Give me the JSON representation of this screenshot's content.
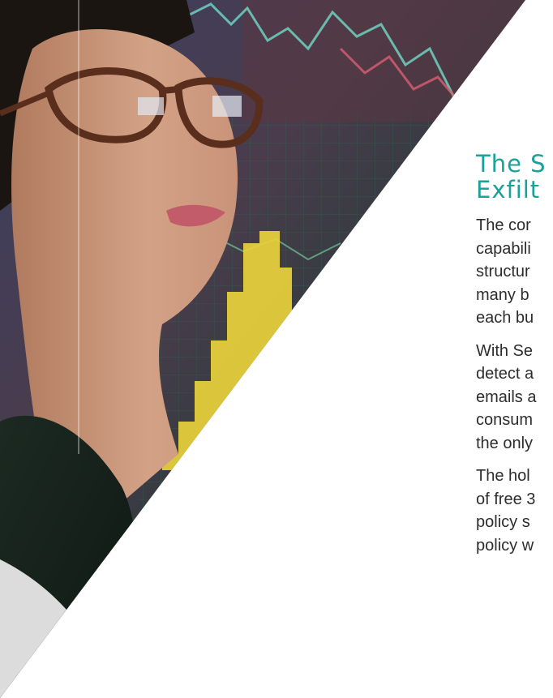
{
  "article": {
    "heading_lines": [
      "The S",
      "Exfilt"
    ],
    "paragraphs": [
      [
        "The cor",
        "capabili",
        "structur",
        "many b",
        "each bu"
      ],
      [
        "With Se",
        "detect a",
        "emails a",
        "consum",
        "the only"
      ],
      [
        "The hol",
        "of free 3",
        "policy s",
        "policy w"
      ]
    ]
  },
  "colors": {
    "accent": "#1aa19a",
    "body_text": "#2d2d2d",
    "background": "#ffffff"
  }
}
